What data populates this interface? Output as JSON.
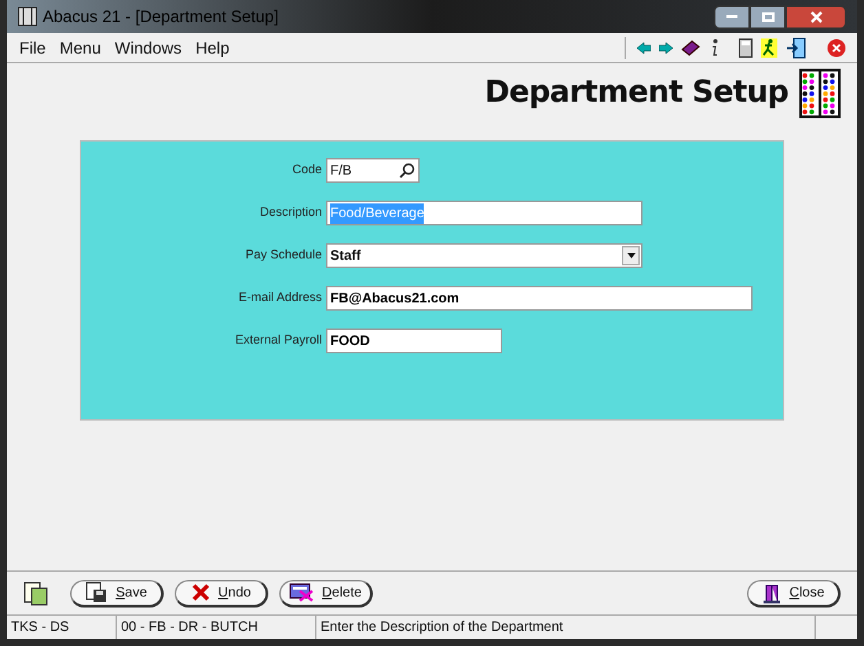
{
  "window": {
    "title": "Abacus 21 - [Department Setup]"
  },
  "menu": [
    "File",
    "Menu",
    "Windows",
    "Help"
  ],
  "page_title": "Department Setup",
  "form": [
    {
      "kind": "lookup",
      "label": "Code",
      "value": "F/B"
    },
    {
      "kind": "text",
      "label": "Description",
      "value": "Food/Beverage",
      "highlighted": true
    },
    {
      "kind": "dropdown",
      "label": "Pay Schedule",
      "value": "Staff"
    },
    {
      "kind": "wide",
      "label": "E-mail Address",
      "value": "FB@Abacus21.com"
    },
    {
      "kind": "short",
      "label": "External Payroll",
      "value": "FOOD"
    }
  ],
  "buttons": [
    {
      "kind": "save",
      "label": "Save"
    },
    {
      "kind": "undo",
      "label": "Undo"
    },
    {
      "kind": "delete",
      "label": "Delete"
    }
  ],
  "close_button": "Close",
  "status_bar": [
    "TKS - DS",
    "00 - FB - DR - BUTCH",
    "Enter the Description of the Department"
  ]
}
